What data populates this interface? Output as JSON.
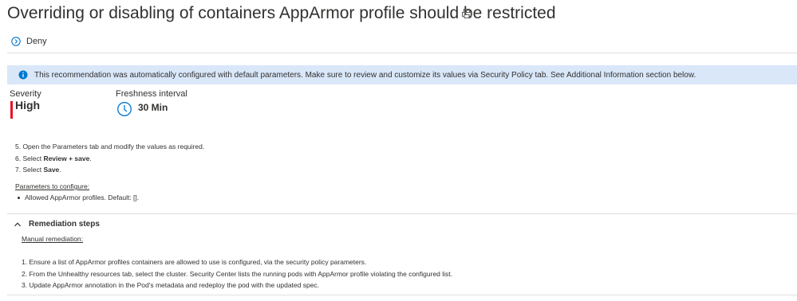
{
  "header": {
    "title": "Overriding or disabling of containers AppArmor profile should be restricted",
    "print_icon": "print-icon"
  },
  "effect": {
    "icon": "chevron-right-circle-icon",
    "label": "Deny"
  },
  "info_banner": {
    "icon": "info-icon",
    "text": "This recommendation was automatically configured with default parameters. Make sure to review and customize its values via Security Policy tab. See Additional Information section below."
  },
  "severity": {
    "label": "Severity",
    "value": "High",
    "color": "#e81123"
  },
  "freshness": {
    "label": "Freshness interval",
    "value": "30 Min",
    "icon": "clock-icon"
  },
  "steps": [
    {
      "prefix": "5. Open the Parameters tab and modify the values as required.",
      "bold": "",
      "suffix": ""
    },
    {
      "prefix": "6. Select ",
      "bold": "Review + save",
      "suffix": "."
    },
    {
      "prefix": "7. Select ",
      "bold": "Save",
      "suffix": "."
    }
  ],
  "parameters": {
    "title": "Parameters to configure:",
    "items": [
      "Allowed AppArmor profiles. Default: []."
    ]
  },
  "remediation": {
    "title": "Remediation steps",
    "toggle_icon": "chevron-up-icon",
    "manual_label": "Manual remediation:",
    "steps": [
      "1. Ensure a list of AppArmor profiles containers are allowed to use is configured, via the security policy parameters.",
      "2. From the Unhealthy resources tab, select the cluster. Security Center lists the running pods with AppArmor profile violating the configured list.",
      "3. Update AppArmor annotation in the Pod's metadata and redeploy the pod with the updated spec."
    ]
  },
  "colors": {
    "info_banner_bg": "#d9e7f9",
    "accent_blue": "#0078d4",
    "text": "#323130"
  }
}
